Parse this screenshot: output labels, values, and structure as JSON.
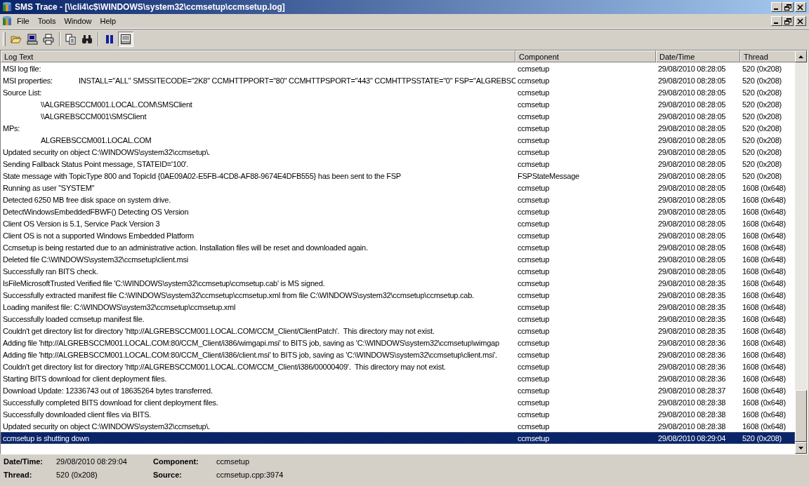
{
  "window": {
    "title": "SMS Trace - [\\\\cli4\\c$\\WINDOWS\\system32\\ccmsetup\\ccmsetup.log]"
  },
  "menu": [
    "File",
    "Tools",
    "Window",
    "Help"
  ],
  "toolbar": [
    {
      "kind": "open",
      "pressed": false
    },
    {
      "kind": "computer",
      "pressed": false
    },
    {
      "kind": "print",
      "pressed": false
    },
    {
      "kind": "copy",
      "pressed": false
    },
    {
      "kind": "find",
      "pressed": false
    },
    {
      "kind": "pause",
      "pressed": false
    },
    {
      "kind": "details",
      "pressed": true
    }
  ],
  "table": {
    "columns": [
      "Log Text",
      "Component",
      "Date/Time",
      "Thread"
    ],
    "rows": [
      {
        "text": "MSI log file:",
        "component": "ccmsetup",
        "time": "29/08/2010 08:28:05",
        "thread": "520 (0x208)",
        "selected": false
      },
      {
        "text": "MSI properties:\tINSTALL=\"ALL\" SMSSITECODE=\"2K8\" CCMHTTPPORT=\"80\" CCMHTTPSPORT=\"443\" CCMHTTPSSTATE=\"0\" FSP=\"ALGREBSC",
        "component": "ccmsetup",
        "time": "29/08/2010 08:28:05",
        "thread": "520 (0x208)",
        "selected": false
      },
      {
        "text": "Source List:",
        "component": "ccmsetup",
        "time": "29/08/2010 08:28:05",
        "thread": "520 (0x208)",
        "selected": false
      },
      {
        "text": "\t\\\\ALGREBSCCM001.LOCAL.COM\\SMSClient",
        "component": "ccmsetup",
        "time": "29/08/2010 08:28:05",
        "thread": "520 (0x208)",
        "selected": false
      },
      {
        "text": "\t\\\\ALGREBSCCM001\\SMSClient",
        "component": "ccmsetup",
        "time": "29/08/2010 08:28:05",
        "thread": "520 (0x208)",
        "selected": false
      },
      {
        "text": "MPs:",
        "component": "ccmsetup",
        "time": "29/08/2010 08:28:05",
        "thread": "520 (0x208)",
        "selected": false
      },
      {
        "text": "\tALGREBSCCM001.LOCAL.COM",
        "component": "ccmsetup",
        "time": "29/08/2010 08:28:05",
        "thread": "520 (0x208)",
        "selected": false
      },
      {
        "text": "Updated security on object C:\\WINDOWS\\system32\\ccmsetup\\.",
        "component": "ccmsetup",
        "time": "29/08/2010 08:28:05",
        "thread": "520 (0x208)",
        "selected": false
      },
      {
        "text": "Sending Fallback Status Point message, STATEID='100'.",
        "component": "ccmsetup",
        "time": "29/08/2010 08:28:05",
        "thread": "520 (0x208)",
        "selected": false
      },
      {
        "text": "State message with TopicType 800 and TopicId {0AE09A02-E5FB-4CD8-AF88-9674E4DFB555} has been sent to the FSP",
        "component": "FSPStateMessage",
        "time": "29/08/2010 08:28:05",
        "thread": "520 (0x208)",
        "selected": false
      },
      {
        "text": "Running as user \"SYSTEM\"",
        "component": "ccmsetup",
        "time": "29/08/2010 08:28:05",
        "thread": "1608 (0x648)",
        "selected": false
      },
      {
        "text": "Detected 6250 MB free disk space on system drive.",
        "component": "ccmsetup",
        "time": "29/08/2010 08:28:05",
        "thread": "1608 (0x648)",
        "selected": false
      },
      {
        "text": "DetectWindowsEmbeddedFBWF() Detecting OS Version",
        "component": "ccmsetup",
        "time": "29/08/2010 08:28:05",
        "thread": "1608 (0x648)",
        "selected": false
      },
      {
        "text": "Client OS Version is 5.1, Service Pack Version 3",
        "component": "ccmsetup",
        "time": "29/08/2010 08:28:05",
        "thread": "1608 (0x648)",
        "selected": false
      },
      {
        "text": "Client OS is not a supported Windows Embedded Platform",
        "component": "ccmsetup",
        "time": "29/08/2010 08:28:05",
        "thread": "1608 (0x648)",
        "selected": false
      },
      {
        "text": "Ccmsetup is being restarted due to an administrative action. Installation files will be reset and downloaded again.",
        "component": "ccmsetup",
        "time": "29/08/2010 08:28:05",
        "thread": "1608 (0x648)",
        "selected": false
      },
      {
        "text": "Deleted file C:\\WINDOWS\\system32\\ccmsetup\\client.msi",
        "component": "ccmsetup",
        "time": "29/08/2010 08:28:05",
        "thread": "1608 (0x648)",
        "selected": false
      },
      {
        "text": "Successfully ran BITS check.",
        "component": "ccmsetup",
        "time": "29/08/2010 08:28:05",
        "thread": "1608 (0x648)",
        "selected": false
      },
      {
        "text": "IsFileMicrosoftTrusted Verified file 'C:\\WINDOWS\\system32\\ccmsetup\\ccmsetup.cab' is MS signed.",
        "component": "ccmsetup",
        "time": "29/08/2010 08:28:35",
        "thread": "1608 (0x648)",
        "selected": false
      },
      {
        "text": "Successfully extracted manifest file C:\\WINDOWS\\system32\\ccmsetup\\ccmsetup.xml from file C:\\WINDOWS\\system32\\ccmsetup\\ccmsetup.cab.",
        "component": "ccmsetup",
        "time": "29/08/2010 08:28:35",
        "thread": "1608 (0x648)",
        "selected": false
      },
      {
        "text": "Loading manifest file: C:\\WINDOWS\\system32\\ccmsetup\\ccmsetup.xml",
        "component": "ccmsetup",
        "time": "29/08/2010 08:28:35",
        "thread": "1608 (0x648)",
        "selected": false
      },
      {
        "text": "Successfully loaded ccmsetup manifest file.",
        "component": "ccmsetup",
        "time": "29/08/2010 08:28:35",
        "thread": "1608 (0x648)",
        "selected": false
      },
      {
        "text": "Couldn't get directory list for directory 'http://ALGREBSCCM001.LOCAL.COM/CCM_Client/ClientPatch'.  This directory may not exist.",
        "component": "ccmsetup",
        "time": "29/08/2010 08:28:35",
        "thread": "1608 (0x648)",
        "selected": false
      },
      {
        "text": "Adding file 'http://ALGREBSCCM001.LOCAL.COM:80/CCM_Client/i386/wimgapi.msi' to BITS job, saving as 'C:\\WINDOWS\\system32\\ccmsetup\\wimgap",
        "component": "ccmsetup",
        "time": "29/08/2010 08:28:36",
        "thread": "1608 (0x648)",
        "selected": false
      },
      {
        "text": "Adding file 'http://ALGREBSCCM001.LOCAL.COM:80/CCM_Client/i386/client.msi' to BITS job, saving as 'C:\\WINDOWS\\system32\\ccmsetup\\client.msi'.",
        "component": "ccmsetup",
        "time": "29/08/2010 08:28:36",
        "thread": "1608 (0x648)",
        "selected": false
      },
      {
        "text": "Couldn't get directory list for directory 'http://ALGREBSCCM001.LOCAL.COM/CCM_Client/i386/00000409'.  This directory may not exist.",
        "component": "ccmsetup",
        "time": "29/08/2010 08:28:36",
        "thread": "1608 (0x648)",
        "selected": false
      },
      {
        "text": "Starting BITS download for client deployment files.",
        "component": "ccmsetup",
        "time": "29/08/2010 08:28:36",
        "thread": "1608 (0x648)",
        "selected": false
      },
      {
        "text": "Download Update: 12336743 out of 18635264 bytes transferred.",
        "component": "ccmsetup",
        "time": "29/08/2010 08:28:37",
        "thread": "1608 (0x648)",
        "selected": false
      },
      {
        "text": "Successfully completed BITS download for client deployment files.",
        "component": "ccmsetup",
        "time": "29/08/2010 08:28:38",
        "thread": "1608 (0x648)",
        "selected": false
      },
      {
        "text": "Successfully downloaded client files via BITS.",
        "component": "ccmsetup",
        "time": "29/08/2010 08:28:38",
        "thread": "1608 (0x648)",
        "selected": false
      },
      {
        "text": "Updated security on object C:\\WINDOWS\\system32\\ccmsetup\\.",
        "component": "ccmsetup",
        "time": "29/08/2010 08:28:38",
        "thread": "1608 (0x648)",
        "selected": false
      },
      {
        "text": "ccmsetup is shutting down",
        "component": "ccmsetup",
        "time": "29/08/2010 08:29:04",
        "thread": "520 (0x208)",
        "selected": true
      }
    ]
  },
  "details": [
    {
      "label": "Date/Time:",
      "value": "29/08/2010 08:29:04"
    },
    {
      "label": "Component:",
      "value": "ccmsetup"
    },
    {
      "label": "Thread:",
      "value": "520 (0x208)"
    },
    {
      "label": "Source:",
      "value": "ccmsetup.cpp:3974"
    }
  ]
}
